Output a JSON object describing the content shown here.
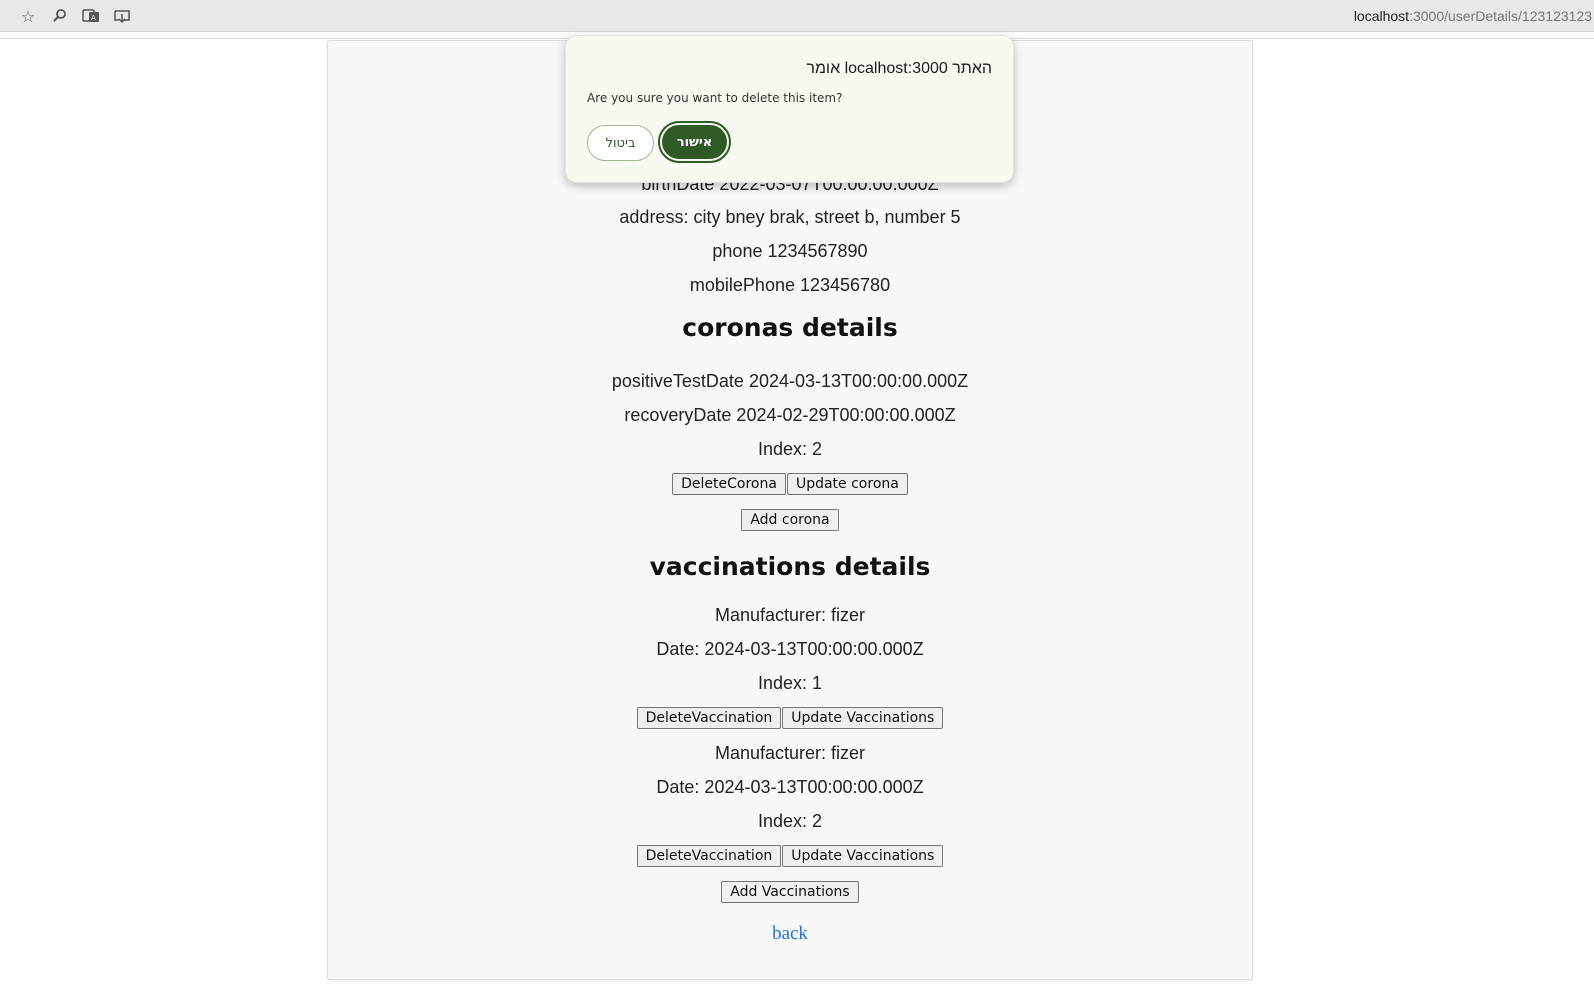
{
  "browser": {
    "url_host": "localhost",
    "url_path": ":3000/userDetails/123123123",
    "icons": [
      "star-icon",
      "zoom-icon",
      "translate-icon",
      "install-icon"
    ]
  },
  "user": {
    "birthDate_line": "birthDate 2022-03-07T00:00:00.000Z",
    "address_line": "address: city bney brak, street b, number 5",
    "phone_line": "phone 1234567890",
    "mobilePhone_line": "mobilePhone 123456780"
  },
  "coronas": {
    "heading": "coronas details",
    "items": [
      {
        "positive": "positiveTestDate 2024-03-13T00:00:00.000Z",
        "recovery": "recoveryDate 2024-02-29T00:00:00.000Z",
        "index": "Index: 2",
        "delete_label": "DeleteCorona",
        "update_label": "Update corona"
      }
    ],
    "add_label": "Add corona"
  },
  "vaccinations": {
    "heading": "vaccinations details",
    "items": [
      {
        "manufacturer": "Manufacturer: fizer",
        "date": "Date: 2024-03-13T00:00:00.000Z",
        "index": "Index: 1",
        "delete_label": "DeleteVaccination",
        "update_label": "Update Vaccinations"
      },
      {
        "manufacturer": "Manufacturer: fizer",
        "date": "Date: 2024-03-13T00:00:00.000Z",
        "index": "Index: 2",
        "delete_label": "DeleteVaccination",
        "update_label": "Update Vaccinations"
      }
    ],
    "add_label": "Add Vaccinations"
  },
  "back_label": "back",
  "dialog": {
    "title": "האתר localhost:3000 אומר",
    "message": "Are you sure you want to delete this item?",
    "ok_label": "אישור",
    "cancel_label": "ביטול"
  },
  "colors": {
    "dialog_ok_bg": "#2f5a26",
    "link": "#1a73e8"
  }
}
